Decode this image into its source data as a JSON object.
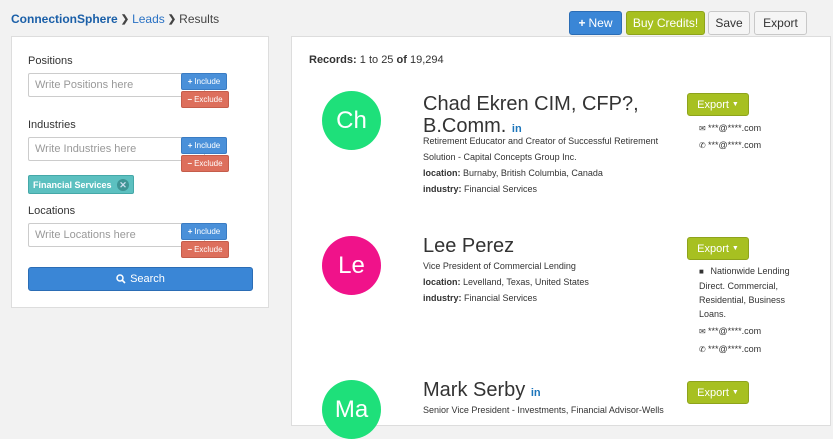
{
  "breadcrumb": {
    "brand": "ConnectionSphere",
    "sep": "❯",
    "leads": "Leads",
    "current": "Results"
  },
  "toolbar": {
    "new_label": "New",
    "credits_label": "Buy Credits!",
    "save_label": "Save",
    "export_label": "Export"
  },
  "filters": {
    "positions": {
      "label": "Positions",
      "placeholder": "Write Positions here"
    },
    "industries": {
      "label": "Industries",
      "placeholder": "Write Industries here",
      "tag": "Financial Services"
    },
    "locations": {
      "label": "Locations",
      "placeholder": "Write Locations here"
    },
    "include": "Include",
    "exclude": "Exclude",
    "search": "Search"
  },
  "records": {
    "label": "Records:",
    "from": "1",
    "to": "25",
    "of_word": "of",
    "to_word": "to",
    "total": "19,294"
  },
  "leads": [
    {
      "initials": "Ch",
      "color": "#1ee07a",
      "name_line1": "Chad Ekren CIM, CFP?,",
      "name_line2": "B.Comm.",
      "title": "Retirement Educator and Creator of Successful Retirement Solution - Capital Concepts Group Inc.",
      "location_key": "location:",
      "location": "Burnaby, British Columbia, Canada",
      "industry_key": "industry:",
      "industry": "Financial Services",
      "export": "Export",
      "email": "***@****.com",
      "phone": "***@****.com"
    },
    {
      "initials": "Le",
      "color": "#f0128a",
      "name_line1": "Lee Perez",
      "title": "Vice President of Commercial Lending",
      "location_key": "location:",
      "location": "Levelland, Texas, United States",
      "industry_key": "industry:",
      "industry": "Financial Services",
      "export": "Export",
      "company": "Nationwide Lending Direct. Commercial, Residential, Business Loans.",
      "email": "***@****.com",
      "phone": "***@****.com"
    },
    {
      "initials": "Ma",
      "color": "#1ee07a",
      "name_line1": "Mark Serby",
      "title": "Senior Vice President - Investments, Financial Advisor-Wells",
      "export": "Export"
    }
  ],
  "linkedin": "in"
}
